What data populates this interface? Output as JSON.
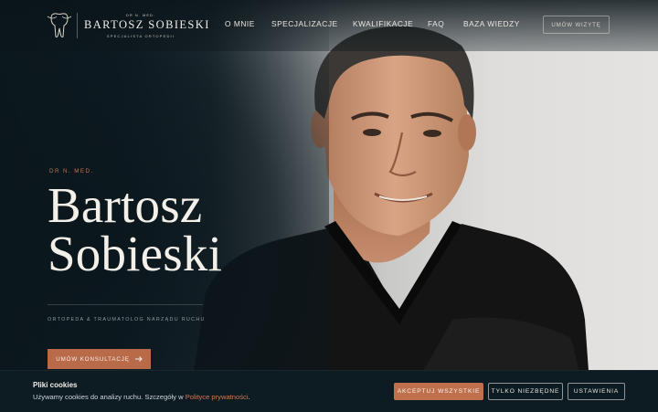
{
  "colors": {
    "accent": "#c0704d",
    "background": "#0f1c22",
    "text": "#f3efe9",
    "muted": "#8d9a9f"
  },
  "logo": {
    "small": "DR N. MED.",
    "name": "BARTOSZ SOBIESKI",
    "sub": "SPECJALISTA ORTOPEDII",
    "icon": "tooth-bone-icon"
  },
  "nav": {
    "items": [
      "O MNIE",
      "SPECJALIZACJE",
      "KWALIFIKACJE",
      "FAQ",
      "BAZA WIEDZY"
    ],
    "cta": "UMÓW WIZYTĘ"
  },
  "hero": {
    "eyebrow": "DR N. MED.",
    "title_line1": "Bartosz",
    "title_line2": "Sobieski",
    "subtitle": "ORTOPEDA & TRAUMATOLOG NARZĄDU RUCHU",
    "button": "UMÓW KONSULTACJĘ",
    "button_icon": "arrow-right-icon"
  },
  "cookie": {
    "title": "Pliki cookies",
    "text": "Używamy cookies do analizy ruchu. Szczegóły w ",
    "link": "Polityce prywatności",
    "text_end": ".",
    "accept": "AKCEPTUJ WSZYSTKIE",
    "necessary": "TYLKO NIEZBĘDNE",
    "settings": "USTAWIENIA"
  }
}
